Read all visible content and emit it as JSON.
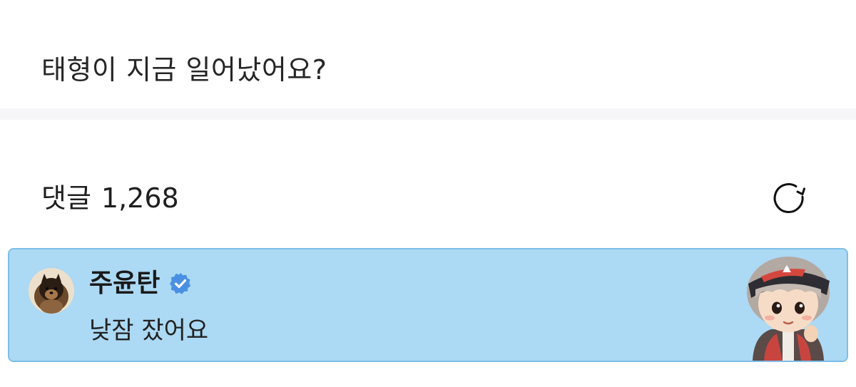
{
  "post": {
    "text": "태형이 지금 일어났어요?"
  },
  "comments": {
    "title": "댓글",
    "count": "1,268",
    "refresh_icon": "refresh-icon"
  },
  "comment_list": [
    {
      "author": "주윤탄",
      "verified": true,
      "text": "낮잠 잤어요",
      "highlight_color": "#acd9f4"
    }
  ],
  "colors": {
    "verified_badge": "#4a90e2",
    "highlight_border": "#7fbfe6",
    "divider": "#f6f6f9"
  }
}
